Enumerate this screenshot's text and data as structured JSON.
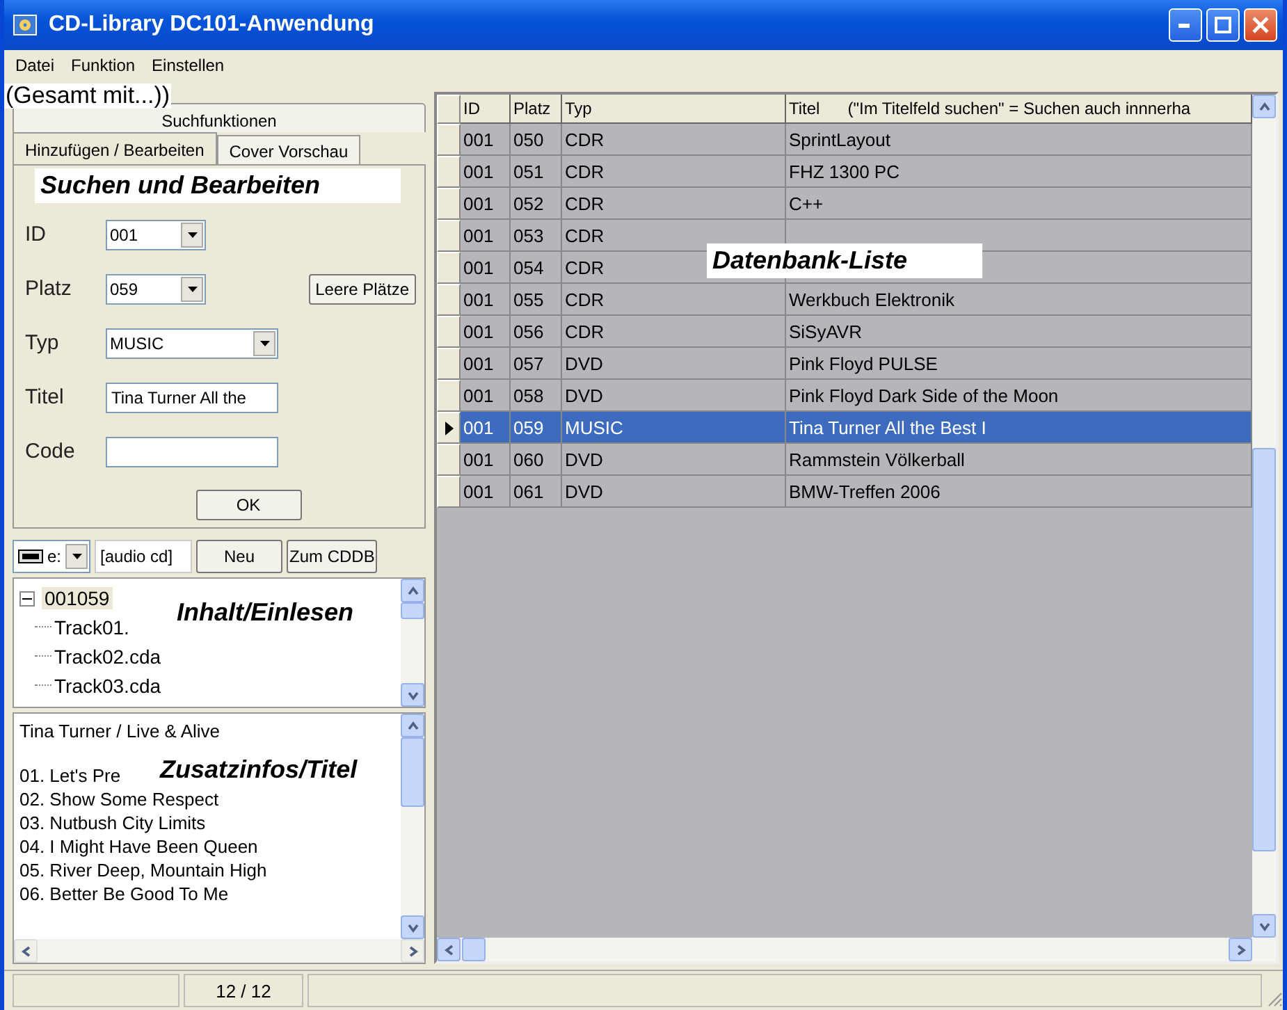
{
  "window": {
    "title": "CD-Library DC101-Anwendung"
  },
  "menu": [
    "Datei",
    "Funktion",
    "Einstellen"
  ],
  "annotations": [
    {
      "text": "(Gesamt mit...))",
      "kind": "plain"
    },
    {
      "text": "Suchen und Bearbeiten",
      "kind": "label"
    },
    {
      "text": "Datenbank-Liste",
      "kind": "label"
    },
    {
      "text": "Inhalt/Einlesen",
      "kind": "label"
    },
    {
      "text": "Zusatzinfos/Titel",
      "kind": "label"
    }
  ],
  "tabs_top": [
    {
      "label": "Suchfunktionen",
      "selected": false
    }
  ],
  "tabs": [
    {
      "label": "Hinzufügen / Bearbeiten",
      "selected": true
    },
    {
      "label": "Cover Vorschau",
      "selected": false
    }
  ],
  "form": {
    "rows": [
      {
        "label": "ID",
        "kind": "combo",
        "value": "001"
      },
      {
        "label": "Platz",
        "kind": "combo",
        "value": "059",
        "button": "Leere Plätze"
      },
      {
        "label": "Typ",
        "kind": "wide-combo",
        "value": "MUSIC"
      },
      {
        "label": "Titel",
        "kind": "text",
        "value": "Tina Turner All the"
      },
      {
        "label": "Code",
        "kind": "text"
      }
    ],
    "ok_button": "OK"
  },
  "drive_bar": {
    "drive": "e:",
    "media": "[audio cd]",
    "buttons": [
      "Neu",
      "Zum CDDB"
    ]
  },
  "tree": {
    "label": "001059",
    "expanded": true,
    "children": [
      {
        "label": "Track01."
      },
      {
        "label": "Track02.cda"
      },
      {
        "label": "Track03.cda"
      }
    ]
  },
  "info": {
    "heading": "Tina Turner / Live & Alive",
    "lines": [
      "01.  Let's Pre",
      "02.  Show Some Respect",
      "03.  Nutbush City Limits",
      "04.  I Might Have Been Queen",
      "05.  River Deep, Mountain High",
      "06.  Better Be Good To Me"
    ]
  },
  "table": {
    "columns": [
      "ID",
      "Platz",
      "Typ",
      "Titel      (\"Im Titelfeld suchen\" = Suchen auch innnerha"
    ],
    "rows": [
      {
        "id": "001",
        "platz": "050",
        "typ": "CDR",
        "titel": "SprintLayout",
        "selected": false
      },
      {
        "id": "001",
        "platz": "051",
        "typ": "CDR",
        "titel": "FHZ 1300 PC",
        "selected": false
      },
      {
        "id": "001",
        "platz": "052",
        "typ": "CDR",
        "titel": "C++",
        "selected": false
      },
      {
        "id": "001",
        "platz": "053",
        "typ": "CDR",
        "selected": false
      },
      {
        "id": "001",
        "platz": "054",
        "typ": "CDR",
        "selected": false
      },
      {
        "id": "001",
        "platz": "055",
        "typ": "CDR",
        "titel": "Werkbuch Elektronik",
        "selected": false
      },
      {
        "id": "001",
        "platz": "056",
        "typ": "CDR",
        "titel": "SiSyAVR",
        "selected": false
      },
      {
        "id": "001",
        "platz": "057",
        "typ": "DVD",
        "titel": "Pink Floyd PULSE",
        "selected": false
      },
      {
        "id": "001",
        "platz": "058",
        "typ": "DVD",
        "titel": "Pink Floyd Dark Side of the Moon",
        "selected": false
      },
      {
        "id": "001",
        "platz": "059",
        "typ": "MUSIC",
        "titel": "Tina Turner All the Best I",
        "selected": true
      },
      {
        "id": "001",
        "platz": "060",
        "typ": "DVD",
        "titel": "Rammstein Völkerball",
        "selected": false
      },
      {
        "id": "001",
        "platz": "061",
        "typ": "DVD",
        "titel": "BMW-Treffen 2006",
        "selected": false
      }
    ]
  },
  "status_bar": {
    "count": "12 / 12"
  }
}
